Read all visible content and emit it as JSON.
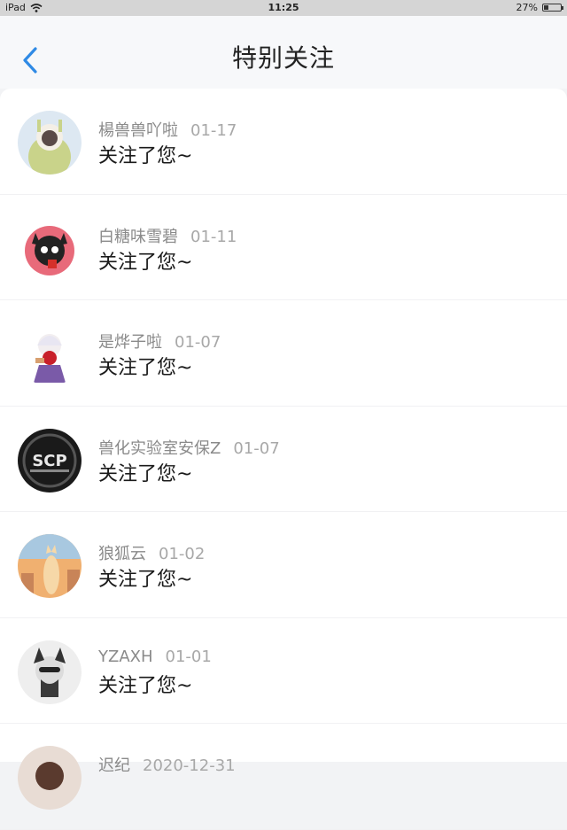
{
  "status_bar": {
    "device": "iPad",
    "time": "11:25",
    "battery": "27%",
    "battery_level": 0.27
  },
  "header": {
    "title": "特别关注",
    "back_icon": "chevron-left-icon",
    "accent_color": "#2f8ae5"
  },
  "items": [
    {
      "name": "楊兽兽吖啦",
      "date": "01-17",
      "message": "关注了您~"
    },
    {
      "name": "白糖味雪碧",
      "date": "01-11",
      "message": "关注了您~"
    },
    {
      "name": "是烨子啦",
      "date": "01-07",
      "message": "关注了您~"
    },
    {
      "name": "兽化实验室安保Z",
      "date": "01-07",
      "message": "关注了您~"
    },
    {
      "name": "狼狐云",
      "date": "01-02",
      "message": "关注了您~"
    },
    {
      "name": "YZAXH",
      "date": "01-01",
      "message": "关注了您~"
    },
    {
      "name": "迟纪",
      "date": "2020-12-31",
      "message": ""
    }
  ]
}
